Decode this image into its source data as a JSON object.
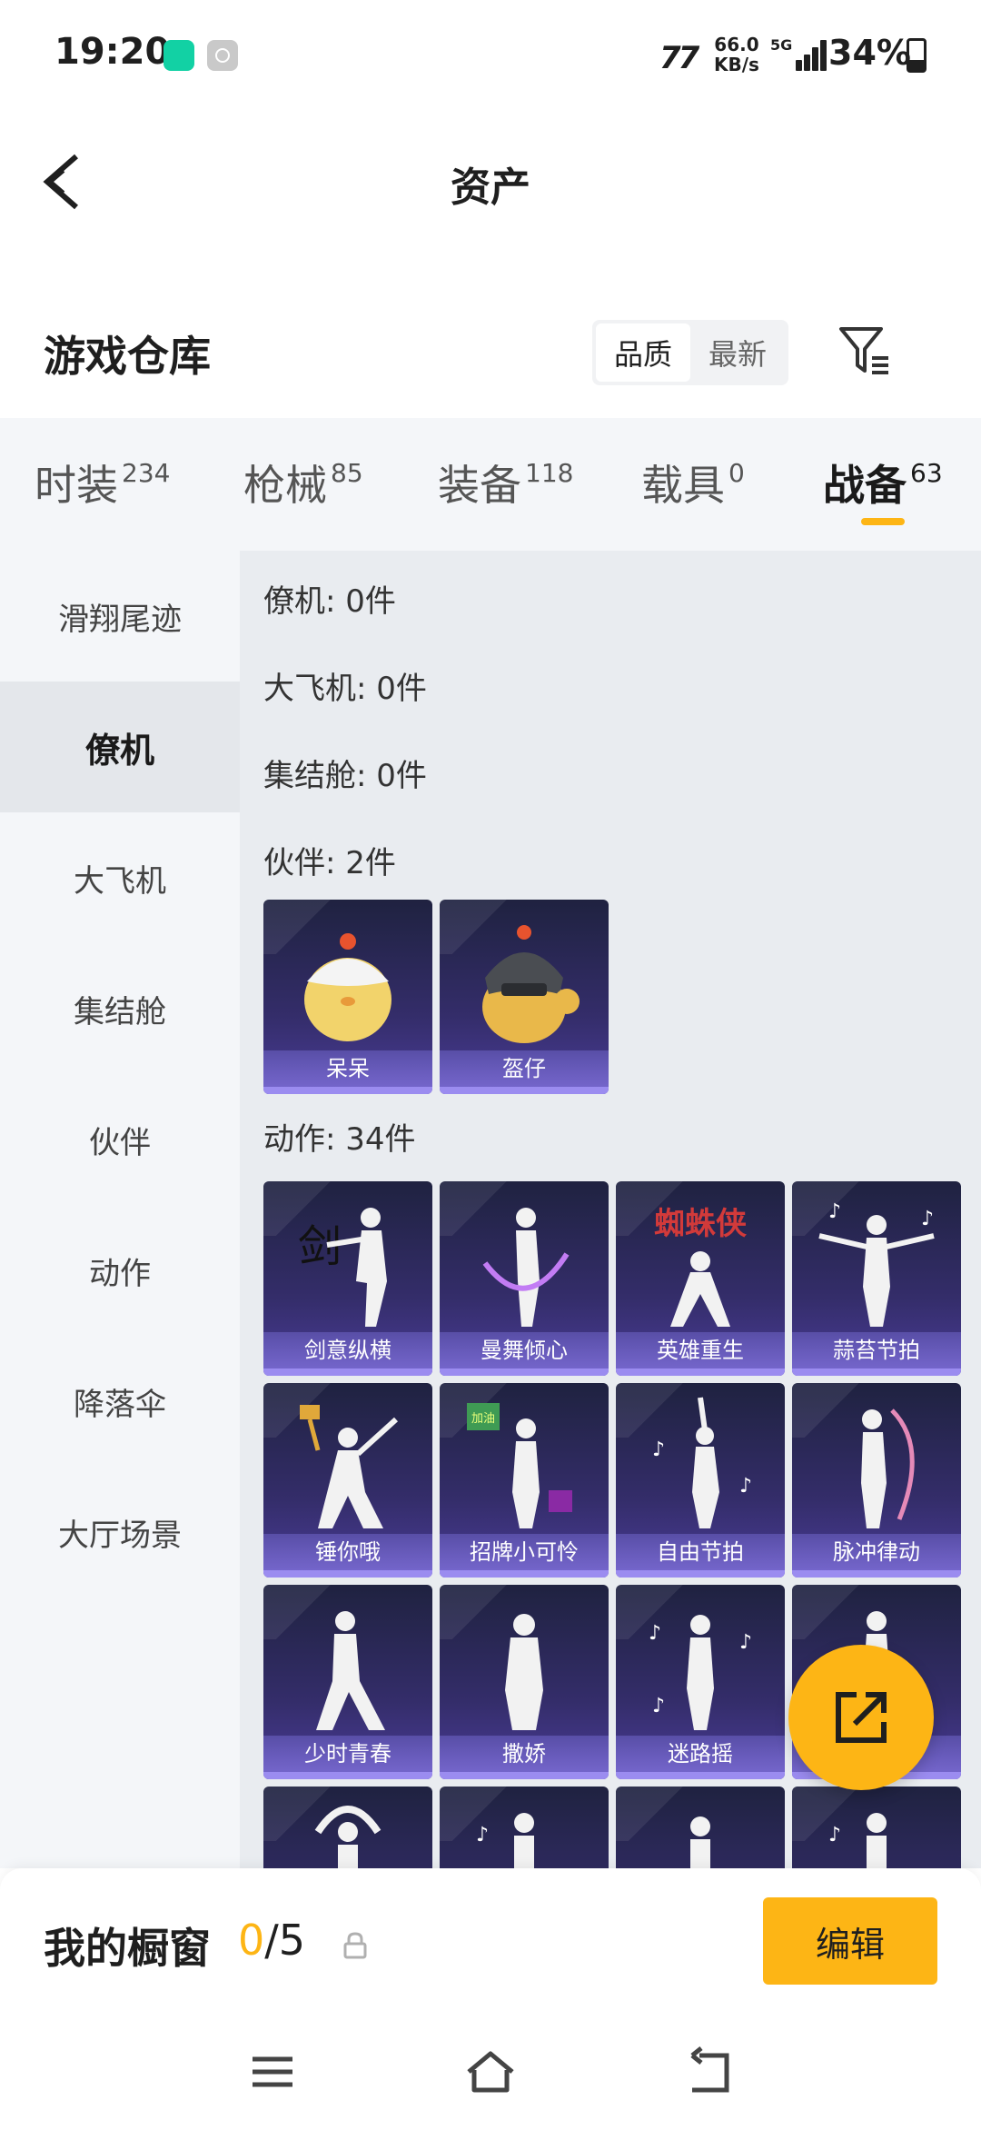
{
  "status_bar": {
    "time": "19:20",
    "net_logo": "77",
    "speed_value": "66.0",
    "speed_unit": "KB/s",
    "network": "5G",
    "battery": "34%"
  },
  "header": {
    "title": "资产"
  },
  "warehouse": {
    "title": "游戏仓库",
    "sort_options": [
      {
        "label": "品质",
        "active": true
      },
      {
        "label": "最新",
        "active": false
      }
    ]
  },
  "category_tabs": [
    {
      "label": "时装",
      "count": "234",
      "active": false
    },
    {
      "label": "枪械",
      "count": "85",
      "active": false
    },
    {
      "label": "装备",
      "count": "118",
      "active": false
    },
    {
      "label": "载具",
      "count": "0",
      "active": false
    },
    {
      "label": "战备",
      "count": "63",
      "active": true
    }
  ],
  "side_nav": [
    {
      "label": "滑翔尾迹",
      "active": false
    },
    {
      "label": "僚机",
      "active": true
    },
    {
      "label": "大飞机",
      "active": false
    },
    {
      "label": "集结舱",
      "active": false
    },
    {
      "label": "伙伴",
      "active": false
    },
    {
      "label": "动作",
      "active": false
    },
    {
      "label": "降落伞",
      "active": false
    },
    {
      "label": "大厅场景",
      "active": false
    }
  ],
  "sections": {
    "wingman": "僚机: 0件",
    "big_plane": "大飞机: 0件",
    "pod": "集结舱: 0件",
    "partner": "伙伴: 2件",
    "emote": "动作: 34件"
  },
  "partner_items": [
    "呆呆",
    "盔仔"
  ],
  "emote_items": [
    "剑意纵横",
    "曼舞倾心",
    "英雄重生",
    "蒜苔节拍",
    "锤你哦",
    "招牌小可怜",
    "自由节拍",
    "脉冲律动",
    "少时青春",
    "撒娇",
    "迷路摇",
    ""
  ],
  "emote_art_text": {
    "hero_poster": "蜘蛛侠",
    "sign_board": "加油"
  },
  "bottom_bar": {
    "showcase_label": "我的橱窗",
    "showcase_current": "0",
    "showcase_total": "/5",
    "edit_label": "编辑"
  },
  "colors": {
    "accent": "#fdb515",
    "card_dark": "#1f2240",
    "card_light": "#4a3c98"
  }
}
